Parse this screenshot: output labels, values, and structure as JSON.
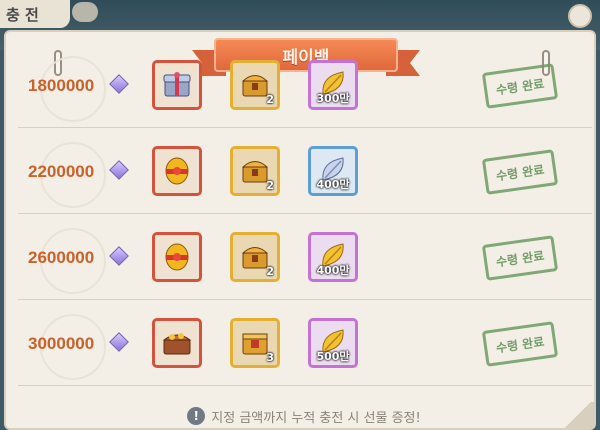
{
  "top_tab": {
    "label": "충 전"
  },
  "banner": {
    "title": "페이백"
  },
  "rows": [
    {
      "amount": "1800000",
      "items": [
        {
          "kind": "red",
          "icon": "gift-chest-icon"
        },
        {
          "kind": "gold",
          "icon": "golden-chest-icon",
          "count": "2"
        },
        {
          "kind": "purple",
          "icon": "gold-leaf-icon",
          "amount": "300만"
        }
      ],
      "status": "수령 완료"
    },
    {
      "amount": "2200000",
      "items": [
        {
          "kind": "red",
          "icon": "golden-egg-icon"
        },
        {
          "kind": "gold",
          "icon": "golden-chest-icon",
          "count": "2"
        },
        {
          "kind": "blue",
          "icon": "silver-leaf-icon",
          "amount": "400만"
        }
      ],
      "status": "수령 완료"
    },
    {
      "amount": "2600000",
      "items": [
        {
          "kind": "red",
          "icon": "golden-egg-icon"
        },
        {
          "kind": "gold",
          "icon": "golden-chest-icon",
          "count": "2"
        },
        {
          "kind": "purple",
          "icon": "gold-leaf-icon",
          "amount": "400만"
        }
      ],
      "status": "수령 완료"
    },
    {
      "amount": "3000000",
      "items": [
        {
          "kind": "red",
          "icon": "treasure-chest-icon"
        },
        {
          "kind": "gold",
          "icon": "golden-box-icon",
          "count": "3"
        },
        {
          "kind": "purple",
          "icon": "gold-leaf-icon",
          "amount": "500만"
        }
      ],
      "status": "수령 완료"
    }
  ],
  "footer": {
    "text": "지정 금액까지 누적 충전 시 선물 증정!"
  },
  "colors": {
    "amount": "#c8612a",
    "stamp": "#5f8e55",
    "banner": "#e0683d"
  }
}
